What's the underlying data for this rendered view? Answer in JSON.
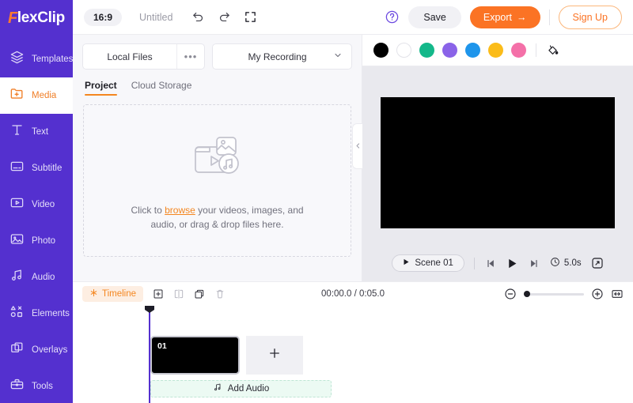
{
  "brand": {
    "logo_first": "F",
    "logo_rest": "lexClip",
    "accent_orange": "#f4861f",
    "sidebar_purple": "#5430cf",
    "export_orange": "#fb7324"
  },
  "sidebar": {
    "items": [
      {
        "label": "Templates",
        "icon": "layers-icon",
        "active": false
      },
      {
        "label": "Media",
        "icon": "media-folder-icon",
        "active": true
      },
      {
        "label": "Text",
        "icon": "text-icon",
        "active": false
      },
      {
        "label": "Subtitle",
        "icon": "subtitle-icon",
        "active": false
      },
      {
        "label": "Video",
        "icon": "video-icon",
        "active": false
      },
      {
        "label": "Photo",
        "icon": "photo-icon",
        "active": false
      },
      {
        "label": "Audio",
        "icon": "audio-note-icon",
        "active": false
      },
      {
        "label": "Elements",
        "icon": "elements-shapes-icon",
        "active": false
      },
      {
        "label": "Overlays",
        "icon": "overlays-icon",
        "active": false
      },
      {
        "label": "Tools",
        "icon": "toolbox-icon",
        "active": false
      }
    ]
  },
  "topbar": {
    "aspect_ratio": "16:9",
    "project_title": "Untitled",
    "undo_icon": "undo-icon",
    "redo_icon": "redo-icon",
    "fullscreen_icon": "expand-icon",
    "help_icon": "help-circle-icon",
    "save_label": "Save",
    "export_label": "Export",
    "export_arrow": "→",
    "signup_label": "Sign Up"
  },
  "media_panel": {
    "local_files_label": "Local Files",
    "more_icon": "ellipsis-icon",
    "my_recording_label": "My Recording",
    "chevron_icon": "chevron-down-icon",
    "tabs": [
      {
        "label": "Project",
        "active": true
      },
      {
        "label": "Cloud Storage",
        "active": false
      }
    ],
    "dropzone": {
      "icon": "media-files-illustration",
      "text_before": "Click to ",
      "link": "browse",
      "text_after": " your videos, images, and",
      "line2": "audio, or drag & drop files here."
    },
    "collapse_icon": "chevron-left-icon"
  },
  "preview": {
    "swatches": [
      {
        "name": "black",
        "hex": "#000000"
      },
      {
        "name": "white",
        "hex": "#ffffff"
      },
      {
        "name": "teal",
        "hex": "#14b88a"
      },
      {
        "name": "purple",
        "hex": "#8a63e8"
      },
      {
        "name": "blue",
        "hex": "#1e95eb"
      },
      {
        "name": "yellow",
        "hex": "#fbbc19"
      },
      {
        "name": "pink",
        "hex": "#f470a8"
      }
    ],
    "fill_icon": "paint-bucket-icon",
    "scene_label": "Scene  01",
    "scene_play_icon": "play-small-icon",
    "prev_icon": "skip-previous-icon",
    "play_icon": "play-icon",
    "next_icon": "skip-next-icon",
    "clock_icon": "clock-icon",
    "duration": "5.0s",
    "fullscreen_icon": "fullscreen-icon"
  },
  "timeline": {
    "badge_label": "Timeline",
    "badge_icon": "timeline-icon",
    "tools": [
      {
        "name": "add-icon"
      },
      {
        "name": "split-icon"
      },
      {
        "name": "duplicate-icon"
      },
      {
        "name": "delete-icon"
      }
    ],
    "time_display": "00:00.0 / 0:05.0",
    "zoom_out_icon": "zoom-out-icon",
    "zoom_in_icon": "zoom-in-icon",
    "fit_icon": "fit-to-screen-icon",
    "zoom_value": 0,
    "clips": [
      {
        "number": "01"
      }
    ],
    "add_clip_icon": "plus-icon",
    "audio_track": {
      "label": "Add Audio",
      "icon": "music-note-icon"
    }
  }
}
